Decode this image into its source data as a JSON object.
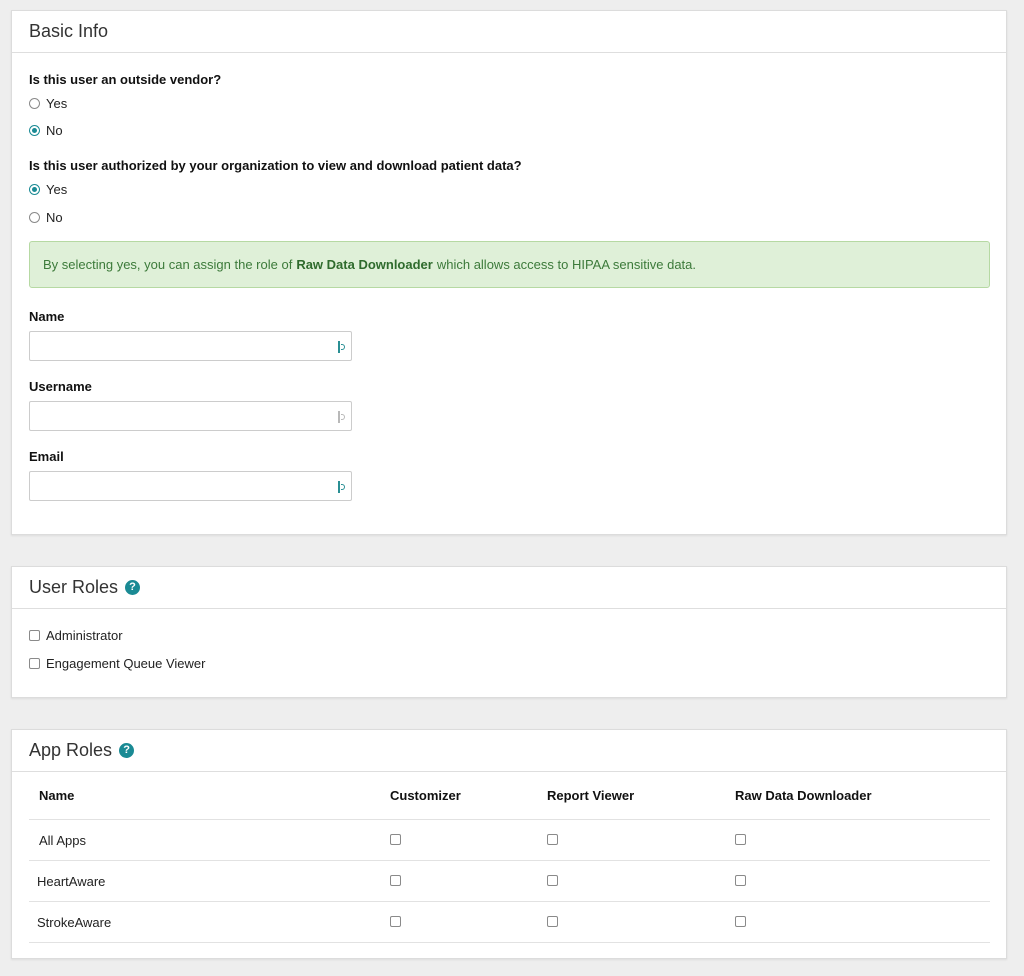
{
  "basic_info": {
    "title": "Basic Info",
    "q1": {
      "label": "Is this user an outside vendor?",
      "options": [
        {
          "label": "Yes",
          "checked": false
        },
        {
          "label": "No",
          "checked": true
        }
      ]
    },
    "q2": {
      "label": "Is this user authorized by your organization to view and download patient data?",
      "options": [
        {
          "label": "Yes",
          "checked": true
        },
        {
          "label": "No",
          "checked": false
        }
      ]
    },
    "alert": {
      "prefix": "By selecting yes, you can assign the role of",
      "bold": "Raw Data Downloader",
      "suffix": "which allows access to HIPAA sensitive data."
    },
    "fields": {
      "name_label": "Name",
      "name_value": "",
      "username_label": "Username",
      "username_value": "",
      "email_label": "Email",
      "email_value": ""
    }
  },
  "user_roles": {
    "title": "User Roles",
    "help_icon": "?",
    "items": [
      {
        "label": "Administrator",
        "checked": false
      },
      {
        "label": "Engagement Queue Viewer",
        "checked": false
      }
    ]
  },
  "app_roles": {
    "title": "App Roles",
    "help_icon": "?",
    "columns": [
      "Name",
      "Customizer",
      "Report Viewer",
      "Raw Data Downloader"
    ],
    "rows": [
      {
        "name": "All Apps"
      },
      {
        "name": "HeartAware"
      },
      {
        "name": "StrokeAware"
      }
    ]
  },
  "colors": {
    "accent": "#1a8a94",
    "alert_bg": "#dff0d8",
    "alert_text": "#3c7a3a"
  }
}
